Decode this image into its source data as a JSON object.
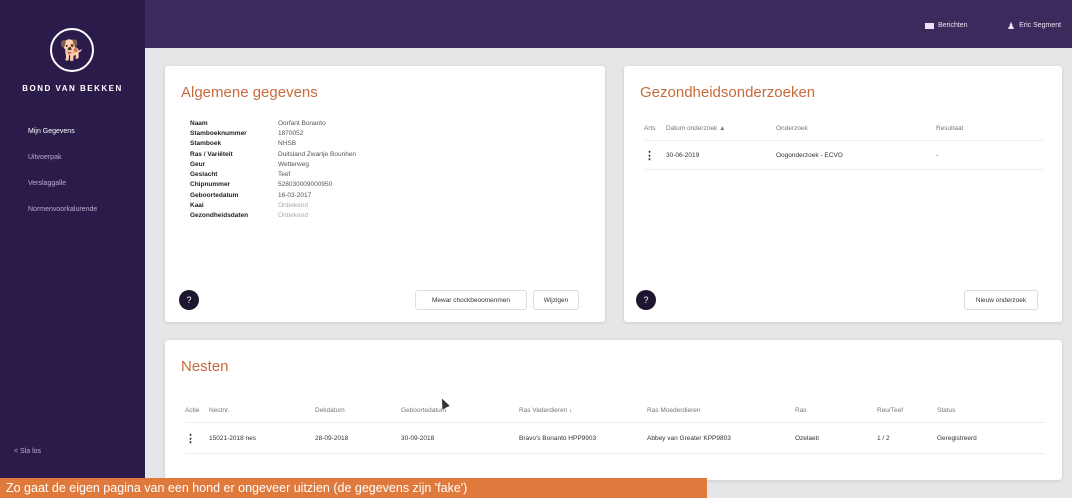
{
  "sidebar": {
    "org_name": "BOND VAN BEKKEN",
    "logo_glyph": "🐕",
    "items": [
      {
        "label": "Mijn Gegevens",
        "active": true
      },
      {
        "label": "Uitvoerpak",
        "active": false
      },
      {
        "label": "Verslaggalle",
        "active": false
      },
      {
        "label": "Normenvoorkalurende",
        "active": false
      }
    ],
    "bottom": "< Sla los"
  },
  "topbar": {
    "messages_label": "Berichten",
    "user_label": "Eric Segment",
    "icons": {
      "messages": "mail-icon",
      "user": "user-icon"
    }
  },
  "general": {
    "title": "Algemene gegevens",
    "rows": [
      {
        "key": "Naam",
        "value": "Oorfant Bonanto"
      },
      {
        "key": "Stamboeknummer",
        "value": "1870052"
      },
      {
        "key": "Stamboek",
        "value": "NHSB"
      },
      {
        "key": "Ras / Variëteit",
        "value": "Duitsland Zwartje Bounhen"
      },
      {
        "key": "Geur",
        "value": "Wetterweg"
      },
      {
        "key": "Geslacht",
        "value": "Teef"
      },
      {
        "key": "Chipnummer",
        "value": "528030009000950"
      },
      {
        "key": "Geboortedatum",
        "value": "16-03-2017"
      },
      {
        "key": "Kaai",
        "value": "Onbekend",
        "muted": true
      },
      {
        "key": "Gezondheidsdaten",
        "value": "Onbekend",
        "muted": true
      }
    ],
    "circle_label": "?",
    "btn_primary": "Mewar chockbeoomenmen",
    "btn_secondary": "Wijzigen"
  },
  "health": {
    "title": "Gezondheidsonderzoeken",
    "headers": [
      "Arts",
      "Datum onderzoek ▲",
      "Onderzoek",
      "Resultaat"
    ],
    "rows": [
      [
        "⋮",
        "30-06-2019",
        "Oogonderzoek - ECVO",
        "-"
      ]
    ],
    "circle_label": "?",
    "btn": "Nieuw onderzoek"
  },
  "litters": {
    "title": "Nesten",
    "headers": [
      "Actie",
      "Nestnr.",
      "Dekdatum",
      "Geboortedatum",
      "Ras Vaderdieren ↓",
      "Ras Moederdieren",
      "Ras",
      "Reu/Teef",
      "Status"
    ],
    "rows": [
      [
        "⋮",
        "15021-2018 nes",
        "28-09-2018",
        "30-09-2018",
        "Bravo's Bonanto HPP9903",
        "Abbey van Greater KPP9803",
        "Ozelaeti",
        "1 / 2",
        "Geregistreerd"
      ]
    ]
  },
  "caption": "Zo gaat de eigen pagina van een hond er ongeveer uitzien (de gegevens zijn 'fake')"
}
